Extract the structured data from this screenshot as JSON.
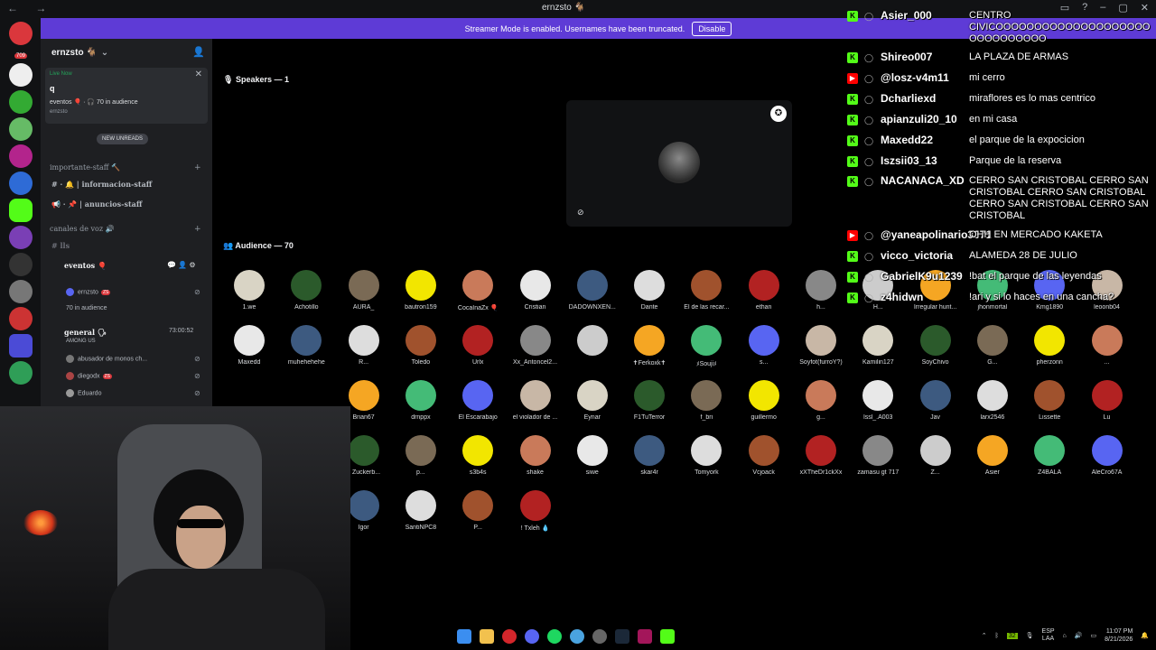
{
  "window": {
    "title": "ernzsto 🐐",
    "nav": "← →",
    "controls": [
      "▭",
      "?",
      "–",
      "▢",
      "✕"
    ]
  },
  "banner": {
    "text": "Streamer Mode is enabled. Usernames have been truncated.",
    "button": "Disable"
  },
  "rail": {
    "badge": "709"
  },
  "sidebar": {
    "guild_name": "ernzsto 🐐",
    "live": {
      "label": "Live Now",
      "query": "q",
      "event": "eventos 🎈 · 🎧 70 in audience",
      "host": "ernzsto"
    },
    "new_unreads": "NEW UNREADS",
    "cat1": "importante-staff 🔨",
    "ch1": "# · 🔔 | informacion-staff",
    "ch2": "📢 · 📌 | anuncios-staff",
    "cat2": "canales de voz 🔊",
    "ch3": "# lls",
    "stage_ch": "eventos 🎈",
    "stage_user": "ernzsto",
    "stage_aud": "70 in audience",
    "voice_ch": "general 🗣",
    "voice_timer": "73:00:52",
    "voice_sub": "AMONG US",
    "voice_users": [
      "abusador de monos ch...",
      "diegodx",
      "Eduardo"
    ],
    "zs": "ZS"
  },
  "stage": {
    "speakers": "Speakers — 1",
    "audience": "Audience — 70",
    "rows": [
      [
        "1.we",
        "Achotillo",
        "AURA_",
        "bautron159",
        "CocaInaZx 🎈",
        "Cristian",
        "DADOWNXEN...",
        "Dante",
        "El de las recar...",
        "ethan",
        "h...",
        "H...",
        "Irregular hunt...",
        "jhonmortal",
        "Kmg1890",
        "leoonb04"
      ],
      [
        "Maxedd",
        "muhehehehe",
        "R...",
        "Toledo",
        "Urlx",
        "Xx_Antoncel2...",
        "",
        "✝Ferkoxk✝",
        "ﾒSoujiﾒ",
        "s...",
        "Soyfot(furroY?)",
        "Kamilin127",
        "SoyChivo",
        "G...",
        "pherzonn",
        "..."
      ],
      [
        "",
        "",
        "Brian67",
        "drnppx",
        "El Escarabajo",
        "el violador de ...",
        "Eynar",
        "F1TuTerror",
        "f_bri",
        "guillermo",
        "g...",
        "lssl_.A003",
        "Jav",
        "larx2546",
        "Lissette",
        "Lu"
      ],
      [
        "",
        "",
        "3 Zuckerb...",
        "p...",
        "s3b4s",
        "shake",
        "siwe",
        "skar4r",
        "Tomyork",
        "Vcjoack",
        "xXTheDr1ckXx",
        "zamasu gt 717",
        "Z...",
        "Asier",
        "Z4BALA",
        "AleCro67A"
      ],
      [
        "",
        "",
        "Igor",
        "SantiNPC8",
        "P...",
        "! Txleh 💧"
      ]
    ]
  },
  "chat": [
    {
      "platform": "K",
      "user": "Asier_000",
      "text": "CENTRO CIVICOOOOOOOOOOOOOOOOOOOOOOOOOOOOOO"
    },
    {
      "platform": "K",
      "user": "Shireo007",
      "text": "LA PLAZA DE ARMAS"
    },
    {
      "platform": "▶",
      "user": "@losz-v4m11",
      "text": "mi cerro"
    },
    {
      "platform": "K",
      "user": "Dcharliexd",
      "text": "miraflores es lo mas centrico"
    },
    {
      "platform": "K",
      "user": "apianzuli20_10",
      "text": "en mi casa"
    },
    {
      "platform": "K",
      "user": "Maxedd22",
      "text": "el parque de la expocicion"
    },
    {
      "platform": "K",
      "user": "Iszsii03_13",
      "text": "Parque de la reserva"
    },
    {
      "platform": "K",
      "user": "NACANACA_XD",
      "text": "CERRO SAN CRISTOBAL CERRO SAN CRISTOBAL CERRO SAN CRISTOBAL CERRO SAN CRISTOBAL CERRO SAN CRISTOBAL"
    },
    {
      "platform": "▶",
      "user": "@yaneapolinario3371",
      "text": "OHH EN MERCADO KAKETA"
    },
    {
      "platform": "K",
      "user": "vicco_victoria",
      "text": "ALAMEDA 28 DE JULIO"
    },
    {
      "platform": "K",
      "user": "GabrielK9u1239",
      "text": "!bat el parque de las leyendas"
    },
    {
      "platform": "K",
      "user": "z4hidwn",
      "text": "!ari y si lo haces en una cancha?"
    }
  ],
  "tray": {
    "lang_top": "ESP",
    "lang_bottom": "LAA",
    "time": "11:07 PM",
    "date": "8/21/2026"
  },
  "colors": {
    "accent": "#5e3bd6",
    "kick": "#53fc18",
    "youtube": "#ff0000",
    "discord": "#5865f2"
  }
}
